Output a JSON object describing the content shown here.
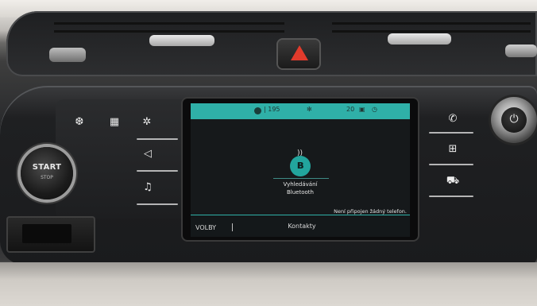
{
  "hazard": {
    "icon": "hazard-warning-icon"
  },
  "start_button": {
    "label": "START",
    "sublabel": "STOP"
  },
  "left_controls": {
    "buttons": [
      {
        "icon": "front-defrost-icon",
        "glyph": "❆"
      },
      {
        "icon": "rear-defrost-icon",
        "glyph": "▦"
      },
      {
        "icon": "climate-icon",
        "glyph": "✲"
      },
      {
        "icon": "navigation-icon",
        "glyph": "◁"
      },
      {
        "icon": "music-note-icon",
        "glyph": "♫"
      }
    ]
  },
  "screen": {
    "topbar": {
      "climate_value": "| 195",
      "fan_icon": "fan-icon",
      "volume_value": "20",
      "clock_icon": "clock-icon"
    },
    "bluetooth": {
      "icon": "bluetooth-icon",
      "glyph": "ʙ",
      "line1": "Vyhledávání",
      "line2": "Bluetooth"
    },
    "status_message": "Není připojen žádný telefon.",
    "bottombar": {
      "left_label": "VOLBY",
      "center_label": "Kontakty"
    }
  },
  "right_controls": {
    "buttons": [
      {
        "icon": "phone-icon",
        "glyph": "✆"
      },
      {
        "icon": "apps-grid-icon",
        "glyph": "⊞"
      },
      {
        "icon": "car-icon",
        "glyph": "⛟"
      }
    ]
  },
  "power_knob": {
    "icon": "power-icon",
    "glyph": "⏻"
  },
  "colors": {
    "accent": "#2fb0a8",
    "hazard": "#e23b2c"
  }
}
